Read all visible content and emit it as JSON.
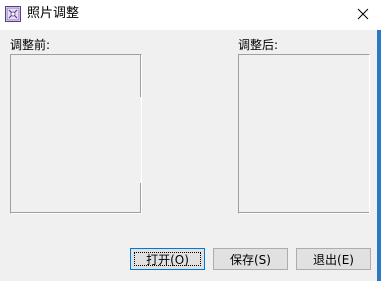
{
  "window": {
    "title": "照片调整",
    "app_icon": "image-adjust-icon",
    "close_icon": "close-icon"
  },
  "labels": {
    "before": "调整前:",
    "after": "调整后:"
  },
  "buttons": {
    "open": "打开(O)",
    "save": "保存(S)",
    "exit": "退出(E)"
  },
  "colors": {
    "accent": "#0078d7",
    "window_bg": "#f0f0f0",
    "frame_edge": "#2b78c6"
  }
}
